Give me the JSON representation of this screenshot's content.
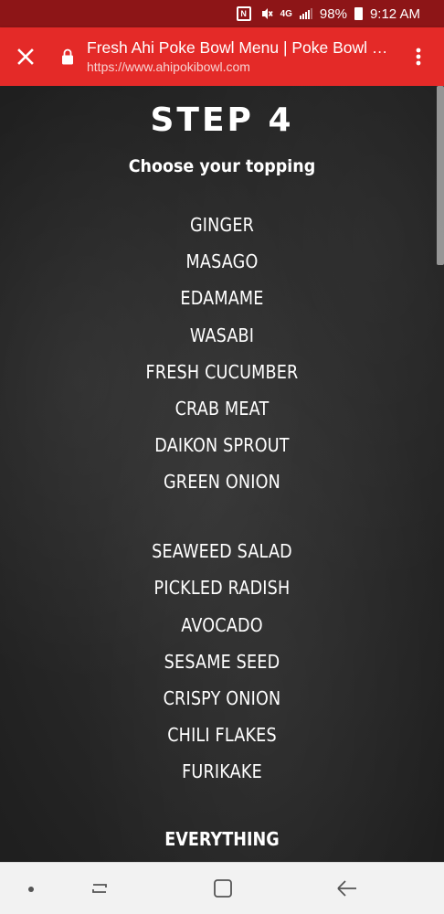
{
  "status_bar": {
    "network_label": "4G",
    "battery_percent": "98%",
    "time": "9:12 AM",
    "signal_bars_filled": 3,
    "icons": [
      "nfc-icon",
      "vibrate-mute-icon",
      "lte-icon",
      "signal-icon",
      "battery-icon"
    ]
  },
  "toolbar": {
    "title": "Fresh Ahi Poke Bowl Menu | Poke Bowl Restaurant",
    "url": "https://www.ahipokibowl.com",
    "icons": [
      "close-icon",
      "lock-icon",
      "overflow-menu-icon"
    ],
    "background_color": "#e42a28",
    "status_color": "#8d1517"
  },
  "content": {
    "step_title": "STEP 4",
    "subtitle": "Choose your topping",
    "toppings_group_1": [
      "GINGER",
      "MASAGO",
      "EDAMAME",
      "WASABI",
      "FRESH CUCUMBER",
      "CRAB MEAT",
      "DAIKON SPROUT",
      "GREEN ONION"
    ],
    "toppings_group_2": [
      "SEAWEED SALAD",
      "PICKLED RADISH",
      "AVOCADO",
      "SESAME SEED",
      "CRISPY ONION",
      "CHILI FLAKES",
      "FURIKAKE"
    ],
    "everything": "EVERYTHING",
    "background_color": "#2b2b2b",
    "text_color": "#ffffff"
  },
  "nav_bar": {
    "buttons": [
      "dot-icon",
      "recent-apps-icon",
      "home-icon",
      "back-icon"
    ]
  }
}
